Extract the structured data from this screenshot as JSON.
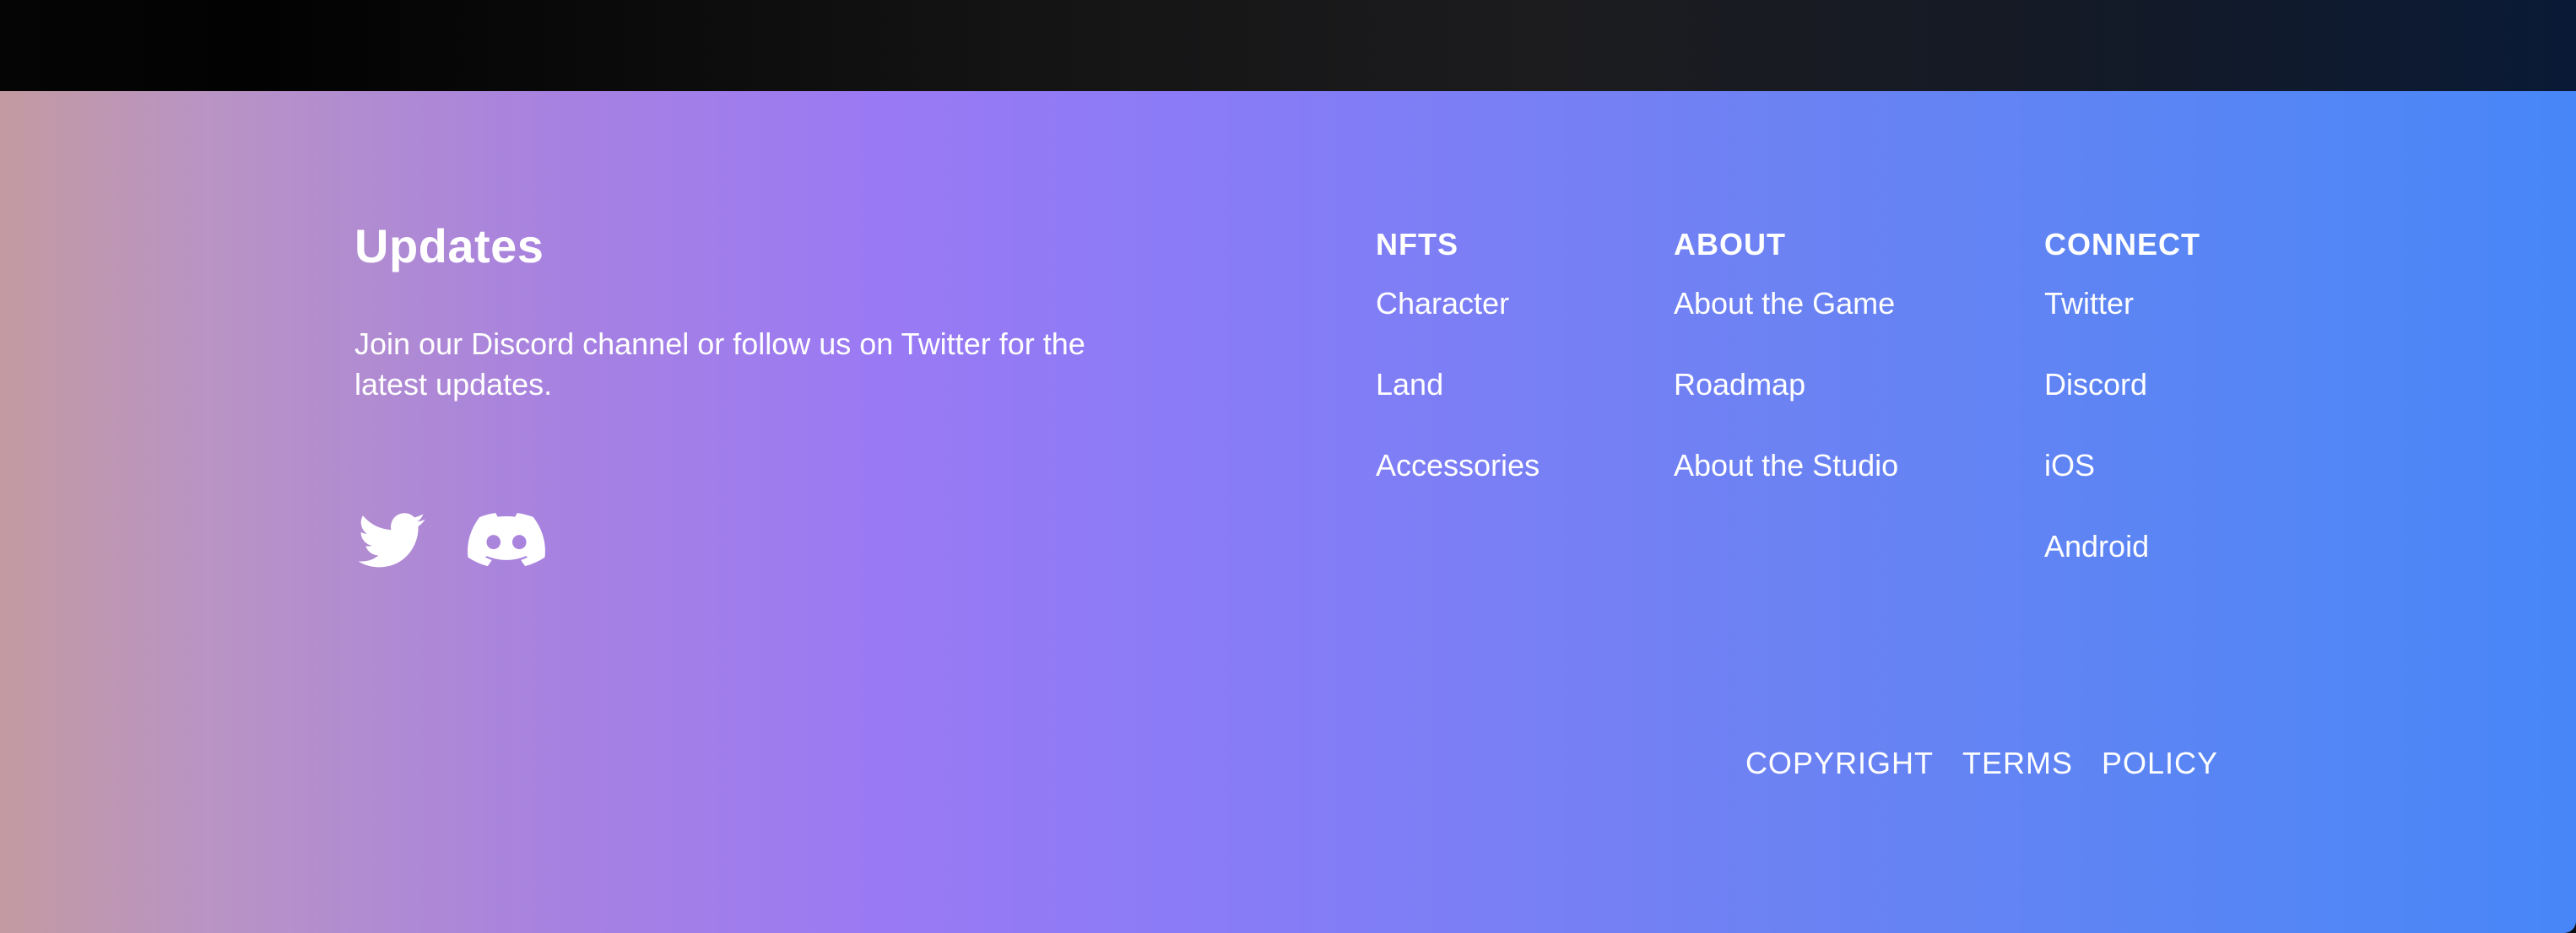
{
  "updates": {
    "title": "Updates",
    "description": "Join our Discord channel or follow us on Twitter for the latest updates."
  },
  "social": {
    "icons": [
      "twitter-icon",
      "discord-icon"
    ]
  },
  "columns": {
    "nfts": {
      "title": "NFTS",
      "items": [
        "Character",
        "Land",
        "Accessories"
      ]
    },
    "about": {
      "title": "ABOUT",
      "items": [
        "About the Game",
        "Roadmap",
        "About the Studio"
      ]
    },
    "connect": {
      "title": "CONNECT",
      "items": [
        "Twitter",
        "Discord",
        "iOS",
        "Android"
      ]
    }
  },
  "legal": {
    "copyright": "COPYRIGHT",
    "terms": "TERMS",
    "policy": "POLICY"
  },
  "colors": {
    "text": "#ffffff",
    "gradient_start": "#c39aa1",
    "gradient_mid": "#9a7af4",
    "gradient_end": "#4786f8"
  }
}
